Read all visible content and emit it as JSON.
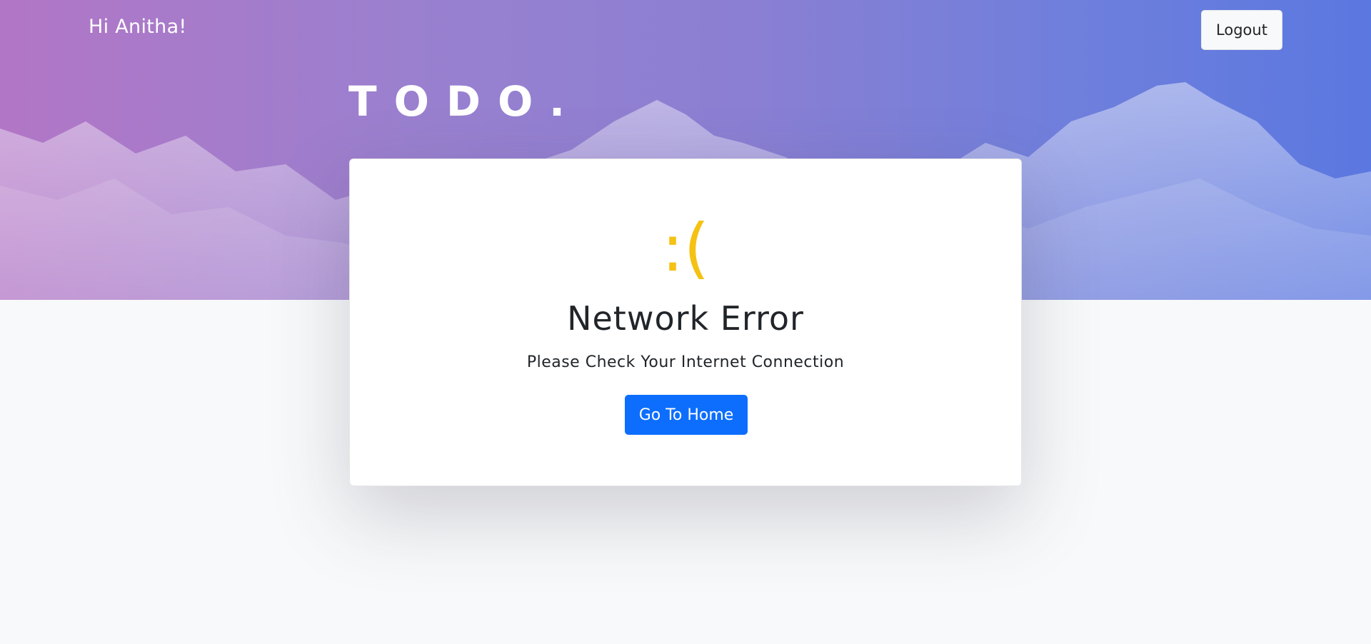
{
  "header": {
    "greeting": "Hi Anitha!",
    "logout_label": "Logout"
  },
  "brand": {
    "logo_text": "TODO."
  },
  "error_card": {
    "icon_text": ":(",
    "title": "Network Error",
    "message": "Please Check Your Internet Connection",
    "home_button_label": "Go To Home"
  },
  "colors": {
    "hero_gradient_start": "#b276c6",
    "hero_gradient_end": "#5b78e0",
    "accent_yellow": "#f5c113",
    "primary_button": "#0d6efd",
    "page_background": "#f8f9fa"
  }
}
